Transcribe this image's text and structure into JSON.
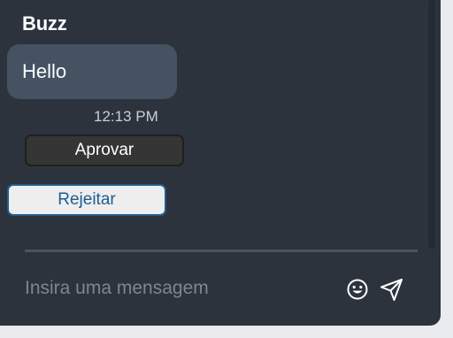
{
  "chat": {
    "sender": "Buzz",
    "message": "Hello",
    "timestamp": "12:13 PM"
  },
  "actions": {
    "approve_label": "Aprovar",
    "reject_label": "Rejeitar"
  },
  "composer": {
    "value": "",
    "placeholder": "Insira uma mensagem",
    "emoji_icon": "emoji-icon",
    "send_icon": "send-icon"
  },
  "colors": {
    "panel_bg": "#2c333d",
    "bubble_bg": "#445261",
    "approve_bg": "#353535",
    "reject_border": "#235d8f"
  }
}
